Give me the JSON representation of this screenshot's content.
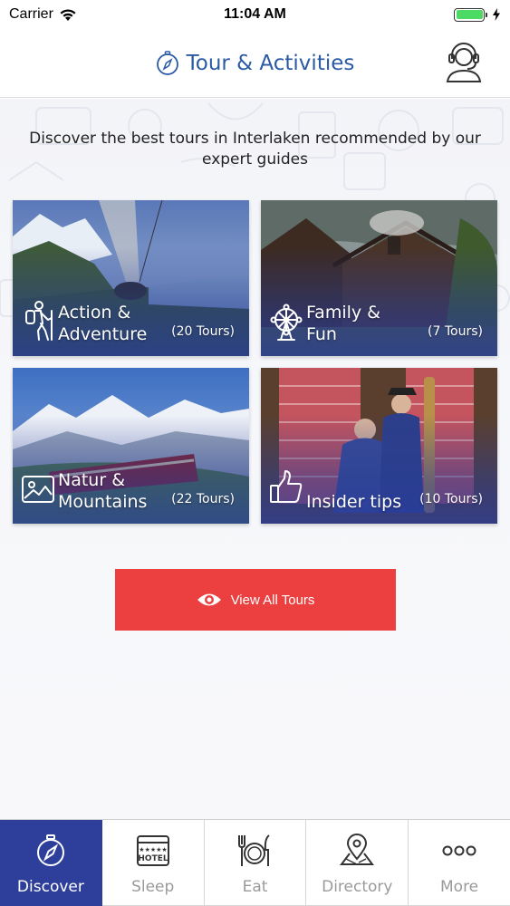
{
  "status_bar": {
    "carrier": "Carrier",
    "time": "11:04 AM"
  },
  "header": {
    "title": "Tour & Activities",
    "title_icon": "compass-icon",
    "support_icon": "headset-icon"
  },
  "main": {
    "intro": "Discover the best tours in Interlaken recommended by our expert guides",
    "categories": [
      {
        "title": "Action & Adventure",
        "count": "(20 Tours)",
        "icon": "hiker-icon"
      },
      {
        "title": "Family & Fun",
        "count": "(7 Tours)",
        "icon": "ferris-wheel-icon"
      },
      {
        "title": "Natur & Mountains",
        "count": "(22 Tours)",
        "icon": "landscape-picture-icon"
      },
      {
        "title": "Insider tips",
        "count": "(10 Tours)",
        "icon": "thumbs-up-icon"
      }
    ],
    "view_all": {
      "label": "View All Tours",
      "icon": "eye-icon"
    }
  },
  "tabbar": {
    "tabs": [
      {
        "label": "Discover",
        "icon": "compass-icon",
        "active": true
      },
      {
        "label": "Sleep",
        "icon": "hotel-icon",
        "active": false
      },
      {
        "label": "Eat",
        "icon": "cutlery-icon",
        "active": false
      },
      {
        "label": "Directory",
        "icon": "map-pin-icon",
        "active": false
      },
      {
        "label": "More",
        "icon": "more-dots-icon",
        "active": false
      }
    ]
  },
  "colors": {
    "accent_blue": "#2a5aa5",
    "active_tab": "#2d3e9b",
    "button_red": "#ec3f40",
    "battery_green": "#4cd964"
  }
}
